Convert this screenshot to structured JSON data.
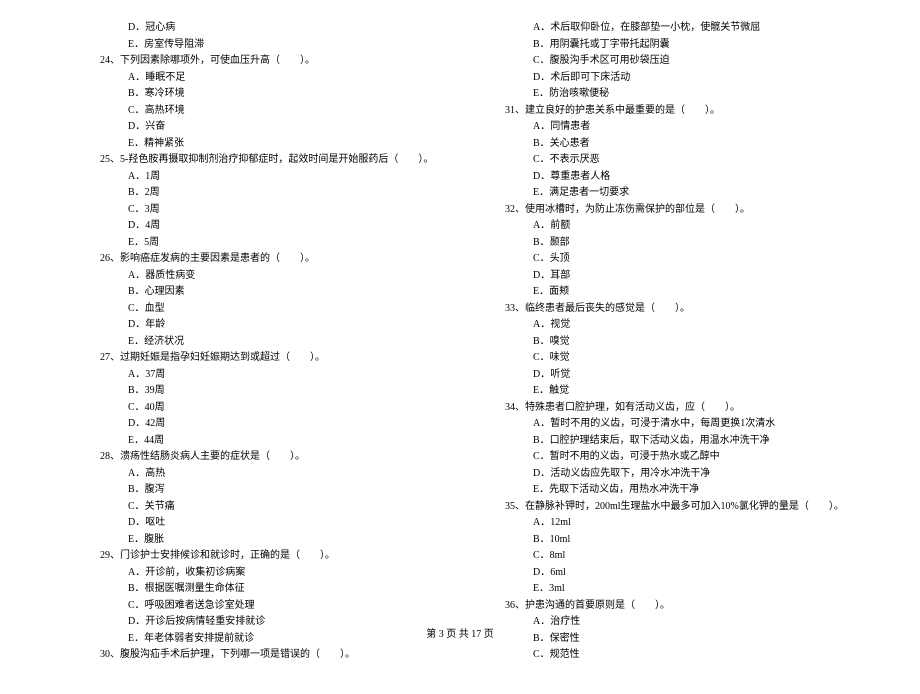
{
  "left_column": [
    {
      "cls": "option",
      "text": "D．冠心病"
    },
    {
      "cls": "option",
      "text": "E．房室传导阻滞"
    },
    {
      "cls": "question",
      "text": "24、下列因素除哪项外，可使血压升高（　　）。"
    },
    {
      "cls": "option",
      "text": "A．睡眠不足"
    },
    {
      "cls": "option",
      "text": "B．寒冷环境"
    },
    {
      "cls": "option",
      "text": "C．高热环境"
    },
    {
      "cls": "option",
      "text": "D．兴奋"
    },
    {
      "cls": "option",
      "text": "E．精神紧张"
    },
    {
      "cls": "question",
      "text": "25、5-羟色胺再摄取抑制剂治疗抑郁症时，起效时间是开始服药后（　　）。"
    },
    {
      "cls": "option",
      "text": "A．1周"
    },
    {
      "cls": "option",
      "text": "B．2周"
    },
    {
      "cls": "option",
      "text": "C．3周"
    },
    {
      "cls": "option",
      "text": "D．4周"
    },
    {
      "cls": "option",
      "text": "E．5周"
    },
    {
      "cls": "question",
      "text": "26、影响癌症发病的主要因素是患者的（　　）。"
    },
    {
      "cls": "option",
      "text": "A．器质性病变"
    },
    {
      "cls": "option",
      "text": "B．心理因素"
    },
    {
      "cls": "option",
      "text": "C．血型"
    },
    {
      "cls": "option",
      "text": "D．年龄"
    },
    {
      "cls": "option",
      "text": "E．经济状况"
    },
    {
      "cls": "question",
      "text": "27、过期妊娠是指孕妇妊娠期达到或超过（　　）。"
    },
    {
      "cls": "option",
      "text": "A．37周"
    },
    {
      "cls": "option",
      "text": "B．39周"
    },
    {
      "cls": "option",
      "text": "C．40周"
    },
    {
      "cls": "option",
      "text": "D．42周"
    },
    {
      "cls": "option",
      "text": "E．44周"
    },
    {
      "cls": "question",
      "text": "28、溃疡性结肠炎病人主要的症状是（　　）。"
    },
    {
      "cls": "option",
      "text": "A．高热"
    },
    {
      "cls": "option",
      "text": "B．腹泻"
    },
    {
      "cls": "option",
      "text": "C．关节痛"
    },
    {
      "cls": "option",
      "text": "D．呕吐"
    },
    {
      "cls": "option",
      "text": "E．腹胀"
    },
    {
      "cls": "question",
      "text": "29、门诊护士安排候诊和就诊时，正确的是（　　）。"
    },
    {
      "cls": "option",
      "text": "A．开诊前，收集初诊病案"
    },
    {
      "cls": "option",
      "text": "B．根据医嘱测量生命体征"
    },
    {
      "cls": "option",
      "text": "C．呼吸困难者送急诊室处理"
    },
    {
      "cls": "option",
      "text": "D．开诊后按病情轻重安排就诊"
    },
    {
      "cls": "option",
      "text": "E．年老体弱者安排提前就诊"
    },
    {
      "cls": "question",
      "text": "30、腹股沟疝手术后护理，下列哪一项是错误的（　　）。"
    }
  ],
  "right_column": [
    {
      "cls": "option",
      "text": "A．术后取仰卧位，在膝部垫一小枕，使髋关节微屈"
    },
    {
      "cls": "option",
      "text": "B．用阴囊托或丁字带托起阴囊"
    },
    {
      "cls": "option",
      "text": "C．腹股沟手术区可用砂袋压迫"
    },
    {
      "cls": "option",
      "text": "D．术后即可下床活动"
    },
    {
      "cls": "option",
      "text": "E．防治咳嗽便秘"
    },
    {
      "cls": "question",
      "text": "31、建立良好的护患关系中最重要的是（　　）。"
    },
    {
      "cls": "option",
      "text": "A．同情患者"
    },
    {
      "cls": "option",
      "text": "B．关心患者"
    },
    {
      "cls": "option",
      "text": "C．不表示厌恶"
    },
    {
      "cls": "option",
      "text": "D．尊重患者人格"
    },
    {
      "cls": "option",
      "text": "E．满足患者一切要求"
    },
    {
      "cls": "question",
      "text": "32、使用冰槽时，为防止冻伤需保护的部位是（　　）。"
    },
    {
      "cls": "option",
      "text": "A．前额"
    },
    {
      "cls": "option",
      "text": "B．颞部"
    },
    {
      "cls": "option",
      "text": "C．头顶"
    },
    {
      "cls": "option",
      "text": "D．耳部"
    },
    {
      "cls": "option",
      "text": "E．面颊"
    },
    {
      "cls": "question",
      "text": "33、临终患者最后丧失的感觉是（　　）。"
    },
    {
      "cls": "option",
      "text": "A．视觉"
    },
    {
      "cls": "option",
      "text": "B．嗅觉"
    },
    {
      "cls": "option",
      "text": "C．味觉"
    },
    {
      "cls": "option",
      "text": "D．听觉"
    },
    {
      "cls": "option",
      "text": "E．触觉"
    },
    {
      "cls": "question",
      "text": "34、特殊患者口腔护理，如有活动义齿，应（　　）。"
    },
    {
      "cls": "option",
      "text": "A．暂时不用的义齿，可浸于清水中，每周更换1次清水"
    },
    {
      "cls": "option",
      "text": "B．口腔护理结束后，取下活动义齿，用温水冲洗干净"
    },
    {
      "cls": "option",
      "text": "C．暂时不用的义齿，可浸于热水或乙醇中"
    },
    {
      "cls": "option",
      "text": "D．活动义齿应先取下，用冷水冲洗干净"
    },
    {
      "cls": "option",
      "text": "E．先取下活动义齿，用热水冲洗干净"
    },
    {
      "cls": "question",
      "text": "35、在静脉补钾时，200ml生理盐水中最多可加入10%氯化钾的量是（　　）。"
    },
    {
      "cls": "option",
      "text": "A．12ml"
    },
    {
      "cls": "option",
      "text": "B．10ml"
    },
    {
      "cls": "option",
      "text": "C．8ml"
    },
    {
      "cls": "option",
      "text": "D．6ml"
    },
    {
      "cls": "option",
      "text": "E．3ml"
    },
    {
      "cls": "question",
      "text": "36、护患沟通的首要原则是（　　）。"
    },
    {
      "cls": "option",
      "text": "A．治疗性"
    },
    {
      "cls": "option",
      "text": "B．保密性"
    },
    {
      "cls": "option",
      "text": "C．规范性"
    }
  ],
  "footer": "第 3 页 共 17 页"
}
